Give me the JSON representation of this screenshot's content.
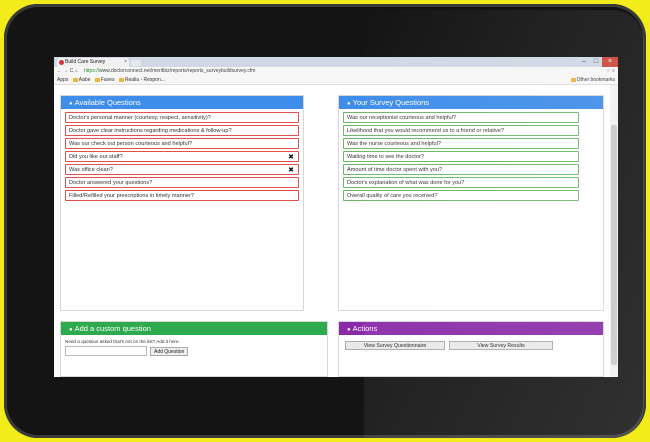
{
  "browser": {
    "tab_title": "Build Care Survey",
    "url_secure": "https://",
    "url_rest": "www.doctorconnect.net/meritbiz/reports/reports_surveybuildsurvey.cfm",
    "bookmarks": [
      "Apps",
      "Aabe",
      "Faves",
      "Realia - Respon..."
    ],
    "other_bookmarks": "Other bookmarks"
  },
  "available": {
    "title": "Available Questions",
    "items": [
      {
        "text": "Doctor's personal manner (courtesy, respect, sensitivity)?",
        "remove": ""
      },
      {
        "text": "Doctor gave clear instructions regarding medications & follow-up?",
        "remove": ""
      },
      {
        "text": "Was our check out person courteous and helpful?",
        "remove": ""
      },
      {
        "text": "Did you like our staff?",
        "remove": "✖"
      },
      {
        "text": "Was office clean?",
        "remove": "✖"
      },
      {
        "text": "Doctor answered your questions?",
        "remove": ""
      },
      {
        "text": "Filled/Refilled your prescriptions in timely manner?",
        "remove": ""
      }
    ]
  },
  "survey": {
    "title": "Your Survey Questions",
    "items": [
      "Was our receptionist courteous and helpful?",
      "Likelihood that you would recommend us to a friend or relative?",
      "Was the nurse courteous and helpful?",
      "Waiting time to see the doctor?",
      "Amount of time doctor spent with you?",
      "Doctor's explanation of what was done for you?",
      "Overall quality of care you received?"
    ]
  },
  "custom": {
    "title": "Add a custom question",
    "prompt": "Need a question asked that's not on the list? Add it here.",
    "input_value": "",
    "button": "Add Question"
  },
  "actions": {
    "title": "Actions",
    "view_questionnaire": "View Survey Questionnaire",
    "view_results": "View Survey Results"
  },
  "colors": {
    "background": "#f2ec1a",
    "available": "#3f8dea",
    "custom": "#2eaa4e",
    "actions": "#8a2aa8"
  }
}
